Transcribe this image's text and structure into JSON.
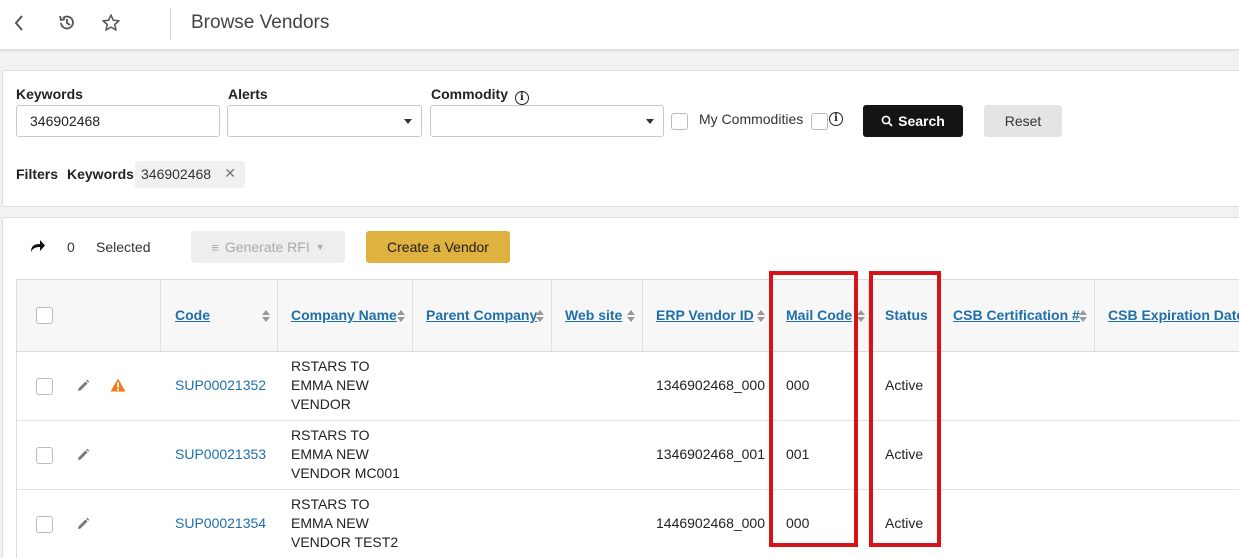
{
  "header": {
    "title": "Browse Vendors"
  },
  "search": {
    "keywords_label": "Keywords",
    "keywords_value": "346902468",
    "alerts_label": "Alerts",
    "commodity_label": "Commodity",
    "my_commodities_label": "My Commodities",
    "search_button": "Search",
    "reset_button": "Reset"
  },
  "filters": {
    "label": "Filters",
    "keyword_label": "Keywords:",
    "keyword_value": "346902468"
  },
  "toolbar": {
    "selected_count": "0",
    "selected_label": "Selected",
    "generate_rfi": "Generate RFI",
    "create_vendor": "Create a Vendor"
  },
  "table": {
    "columns": [
      "Code",
      "Company Name",
      "Parent Company",
      "Web site",
      "ERP Vendor ID",
      "Mail Code",
      "Status",
      "CSB Certification #",
      "CSB Expiration Date"
    ],
    "rows": [
      {
        "code": "SUP00021352",
        "company": "RSTARS TO EMMA NEW VENDOR",
        "erp": "1346902468_000",
        "mail": "000",
        "status": "Active",
        "alert": true
      },
      {
        "code": "SUP00021353",
        "company": "RSTARS TO EMMA NEW VENDOR MC001",
        "erp": "1346902468_001",
        "mail": "001",
        "status": "Active",
        "alert": false
      },
      {
        "code": "SUP00021354",
        "company": "RSTARS TO EMMA NEW VENDOR TEST2",
        "erp": "1446902468_000",
        "mail": "000",
        "status": "Active",
        "alert": false
      }
    ]
  },
  "colors": {
    "link": "#1f6fa8",
    "create_button": "#dfb13f",
    "search_button": "#141414",
    "highlight": "#d7131a",
    "warning": "#ee7d1f"
  }
}
